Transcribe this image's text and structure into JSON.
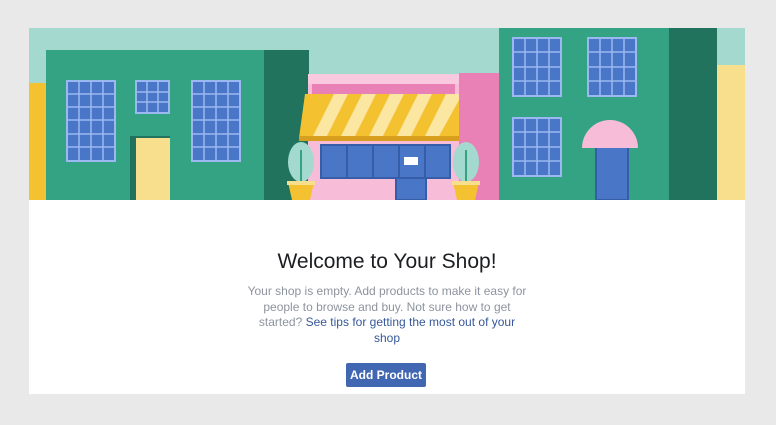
{
  "shop": {
    "title": "Welcome to Your Shop!",
    "description": "Your shop is empty. Add products to make it easy for people to browse and buy. Not sure how to get started?",
    "tips_link": "See tips for getting the most out of your shop",
    "add_product_label": "Add Product"
  },
  "colors": {
    "sky": "#a3d9cf",
    "building_green": "#33a384",
    "building_dark": "#22735d",
    "window_blue": "#4a76c8",
    "awning_yellow": "#f4c130",
    "awning_light": "#fbe7a2",
    "shop_pink": "#f7bcd8",
    "accent_pink": "#ea81b6",
    "button_blue": "#4267b2"
  }
}
